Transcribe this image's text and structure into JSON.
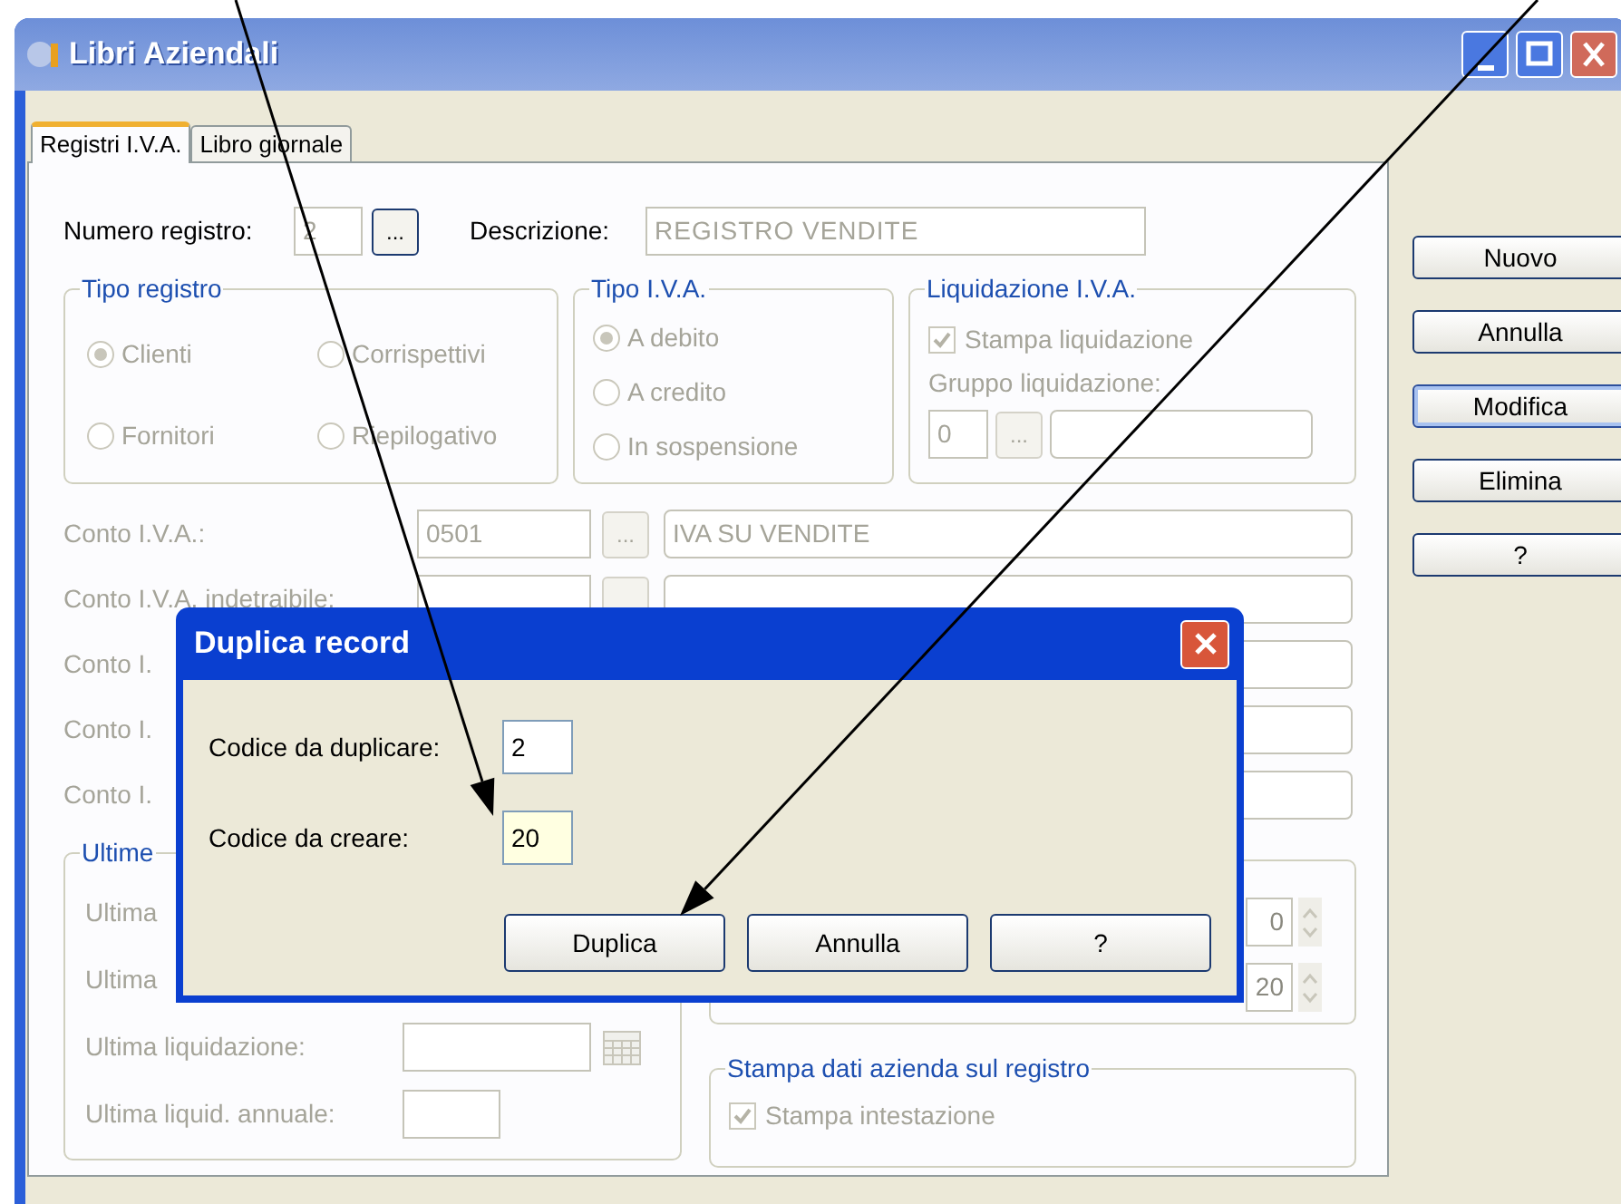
{
  "window": {
    "title": "Libri Aziendali"
  },
  "tabs": [
    {
      "label": "Registri I.V.A.",
      "selected": true
    },
    {
      "label": "Libro giornale",
      "selected": false
    }
  ],
  "header": {
    "numero_label": "Numero registro:",
    "numero_value": "2",
    "browse": "...",
    "descrizione_label": "Descrizione:",
    "descrizione_value": "REGISTRO VENDITE"
  },
  "tipo_registro": {
    "title": "Tipo registro",
    "options": [
      {
        "label": "Clienti",
        "selected": true
      },
      {
        "label": "Corrispettivi",
        "selected": false
      },
      {
        "label": "Fornitori",
        "selected": false
      },
      {
        "label": "Riepilogativo",
        "selected": false
      }
    ]
  },
  "tipo_iva": {
    "title": "Tipo I.V.A.",
    "options": [
      {
        "label": "A debito",
        "selected": true
      },
      {
        "label": "A credito",
        "selected": false
      },
      {
        "label": "In sospensione",
        "selected": false
      }
    ]
  },
  "liquidazione": {
    "title": "Liquidazione I.V.A.",
    "checkbox": {
      "label": "Stampa liquidazione",
      "checked": true
    },
    "gruppo_label": "Gruppo liquidazione:",
    "gruppo_value": "0",
    "browse": "..."
  },
  "conti": [
    {
      "label": "Conto I.V.A.:",
      "code": "0501",
      "browse": "...",
      "description": "IVA SU VENDITE",
      "kind": "full"
    },
    {
      "label": "Conto I.V.A. indetraibile:",
      "kind": "full"
    },
    {
      "label": "Conto I.",
      "kind": "partial"
    },
    {
      "label": "Conto I.",
      "kind": "partial"
    },
    {
      "label": "Conto I.",
      "kind": "partial"
    }
  ],
  "ultime": {
    "title": "Ultime",
    "rows": [
      {
        "label": "Ultima",
        "kind": "label"
      },
      {
        "label": "Ultima",
        "kind": "label"
      },
      {
        "label": "Ultima liquidazione:",
        "kind": "date"
      },
      {
        "label": "Ultima liquid. annuale:",
        "kind": "text"
      }
    ]
  },
  "spinners": [
    {
      "value": "0"
    },
    {
      "value": "20"
    }
  ],
  "stampa_dati": {
    "title": "Stampa dati azienda sul registro",
    "checkbox": {
      "label": "Stampa intestazione",
      "checked": true
    }
  },
  "side_buttons": [
    {
      "label": "Nuovo",
      "focused": false
    },
    {
      "label": "Annulla",
      "focused": false
    },
    {
      "label": "Modifica",
      "focused": true
    },
    {
      "label": "Elimina",
      "focused": false
    },
    {
      "label": "?",
      "focused": false
    }
  ],
  "dialog": {
    "title": "Duplica record",
    "fields": [
      {
        "label": "Codice da duplicare:",
        "value": "2",
        "focused": false
      },
      {
        "label": "Codice da creare:",
        "value": "20",
        "focused": true
      }
    ],
    "buttons": [
      "Duplica",
      "Annulla",
      "?"
    ]
  },
  "annotations": [
    {
      "kind": "arrow"
    },
    {
      "kind": "arrow"
    }
  ]
}
